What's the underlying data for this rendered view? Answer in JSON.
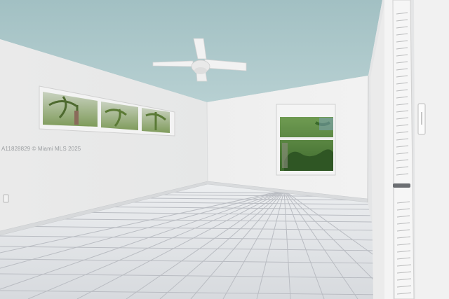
{
  "watermark": {
    "text": "A11828829 © Miami MLS 2025"
  },
  "room": {
    "ceiling_color": "#a9c6c8",
    "wall_color": "#eceded",
    "floor_tile_color": "#e3e5e8",
    "grout_color": "#b9bcc2"
  },
  "objects": {
    "ceiling_fan": "ceiling-fan",
    "left_window": "horizontal-transom-window",
    "right_window": "casement-window",
    "closet_door": "louvered-closet-door"
  }
}
